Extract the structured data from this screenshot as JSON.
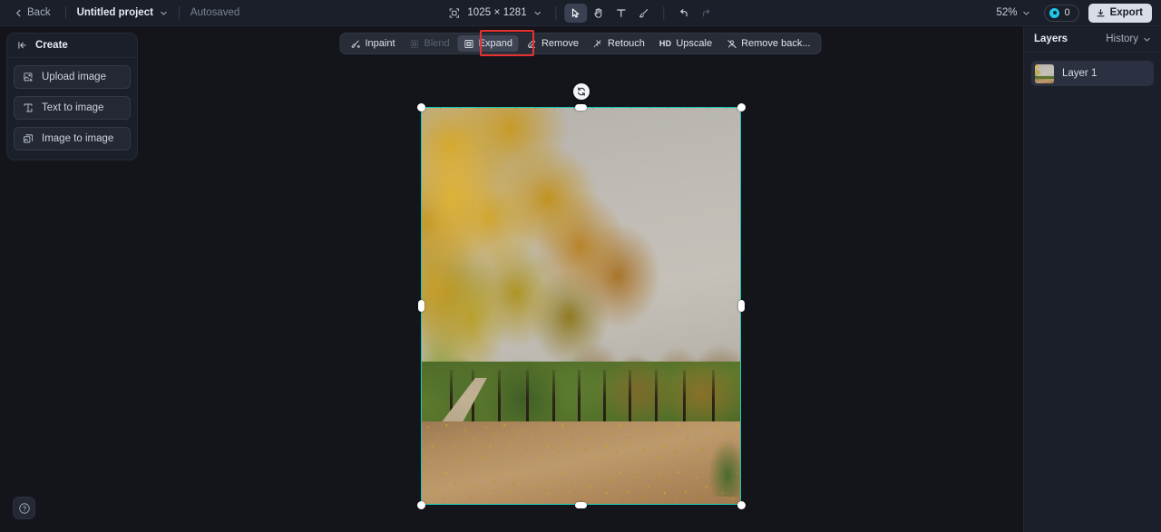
{
  "topbar": {
    "back_label": "Back",
    "back_icon": "chevron-left-icon",
    "project_name": "Untitled project",
    "project_chevron_icon": "chevron-down-icon",
    "autosaved_label": "Autosaved",
    "canvas_size_icon": "canvas-resize-icon",
    "canvas_size": "1025 × 1281",
    "canvas_size_chevron_icon": "chevron-down-icon",
    "tools": [
      {
        "name": "select-tool",
        "icon": "cursor-arrow-icon",
        "active": true,
        "disabled": false
      },
      {
        "name": "hand-tool",
        "icon": "hand-icon",
        "active": false,
        "disabled": false
      },
      {
        "name": "text-tool",
        "icon": "text-icon",
        "active": false,
        "disabled": false
      },
      {
        "name": "brush-tool",
        "icon": "brush-icon",
        "active": false,
        "disabled": false
      },
      {
        "name": "undo-tool",
        "icon": "undo-icon",
        "active": false,
        "disabled": false
      },
      {
        "name": "redo-tool",
        "icon": "redo-icon",
        "active": false,
        "disabled": true
      }
    ],
    "zoom_level": "52%",
    "zoom_chevron_icon": "chevron-down-icon",
    "credits_icon": "credit-coin-icon",
    "credits_count": "0",
    "export_label": "Export",
    "export_icon": "download-icon"
  },
  "left_panel": {
    "title": "Create",
    "collapse_icon": "panel-collapse-icon",
    "items": [
      {
        "label": "Upload image",
        "icon": "upload-image-icon"
      },
      {
        "label": "Text to image",
        "icon": "text-to-image-icon"
      },
      {
        "label": "Image to image",
        "icon": "image-to-image-icon"
      }
    ]
  },
  "action_toolbar": {
    "items": [
      {
        "label": "Inpaint",
        "icon": "inpaint-icon",
        "active": false,
        "disabled": false
      },
      {
        "label": "Blend",
        "icon": "blend-icon",
        "active": false,
        "disabled": true
      },
      {
        "label": "Expand",
        "icon": "expand-icon",
        "active": true,
        "disabled": false
      },
      {
        "label": "Remove",
        "icon": "remove-icon",
        "active": false,
        "disabled": false
      },
      {
        "label": "Retouch",
        "icon": "retouch-icon",
        "active": false,
        "disabled": false
      },
      {
        "label": "Upscale",
        "icon": "hd-icon",
        "active": false,
        "disabled": false,
        "badge": "HD"
      },
      {
        "label": "Remove back...",
        "icon": "remove-background-icon",
        "active": false,
        "disabled": false
      }
    ],
    "annotation": {
      "target": "Expand",
      "color": "#e8312f"
    }
  },
  "canvas": {
    "selection": {
      "rotate_icon": "rotate-handle-icon",
      "border_color": "#16c8b8",
      "handles": [
        "top-left",
        "top-center",
        "top-right",
        "middle-left",
        "middle-right",
        "bottom-left",
        "bottom-center",
        "bottom-right"
      ]
    },
    "image_description": "Autumn park scene with golden-orange trees along a dirt path under an overcast gray sky"
  },
  "right_panel": {
    "title": "Layers",
    "history_label": "History",
    "history_chevron_icon": "chevron-down-icon",
    "layers": [
      {
        "name": "Layer 1",
        "selected": true
      }
    ]
  },
  "help": {
    "icon": "help-question-icon",
    "label": "?"
  },
  "colors": {
    "app_background": "#13151b",
    "panel_background": "#1b1f29",
    "accent_selection": "#16c8b8",
    "accent_credit": "#21c7e8",
    "annotation_red": "#e8312f",
    "export_button": "#d9dee6"
  }
}
